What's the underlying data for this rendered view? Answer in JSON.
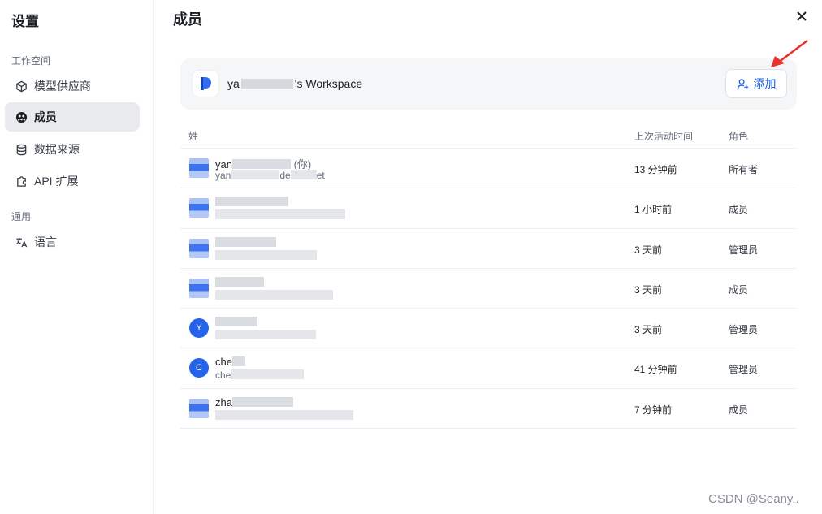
{
  "sidebar": {
    "title": "设置",
    "sections": [
      {
        "label": "工作空间"
      },
      {
        "label": "通用"
      }
    ],
    "items": [
      {
        "label": "模型供应商",
        "icon": "cube-icon"
      },
      {
        "label": "成员",
        "icon": "members-icon",
        "active": true
      },
      {
        "label": "数据来源",
        "icon": "database-icon"
      },
      {
        "label": "API 扩展",
        "icon": "puzzle-icon"
      },
      {
        "label": "语言",
        "icon": "translate-icon"
      }
    ]
  },
  "main": {
    "title": "成员",
    "workspace": {
      "name_prefix": "ya",
      "name_suffix": "'s Workspace",
      "add_label": "添加"
    },
    "table": {
      "headers": [
        "姓",
        "上次活动时间",
        "角色"
      ],
      "rows": [
        {
          "name": "yan",
          "name_note": "(你)",
          "email_prefix": "yan",
          "email_mid": "de",
          "email_suffix": "et",
          "avatar": "",
          "last_active": "13 分钟前",
          "role": "所有者"
        },
        {
          "name": "",
          "email_prefix": "",
          "avatar": "",
          "last_active": "1 小时前",
          "role": "成员"
        },
        {
          "name": "",
          "email_prefix": "",
          "avatar": "",
          "last_active": "3 天前",
          "role": "管理员"
        },
        {
          "name": "",
          "email_prefix": "",
          "avatar": "",
          "last_active": "3 天前",
          "role": "成员"
        },
        {
          "name": "",
          "email_prefix": "",
          "avatar": "Y",
          "last_active": "3 天前",
          "role": "管理员"
        },
        {
          "name": "che",
          "email_prefix": "che",
          "avatar": "C",
          "last_active": "41 分钟前",
          "role": "管理员"
        },
        {
          "name": "zha",
          "email_prefix": "",
          "avatar": "",
          "last_active": "7 分钟前",
          "role": "成员"
        }
      ]
    }
  },
  "watermark": "CSDN @Seany..",
  "colors": {
    "accent": "#155eef",
    "avatar": "#2563eb",
    "arrow": "#e8322b"
  }
}
